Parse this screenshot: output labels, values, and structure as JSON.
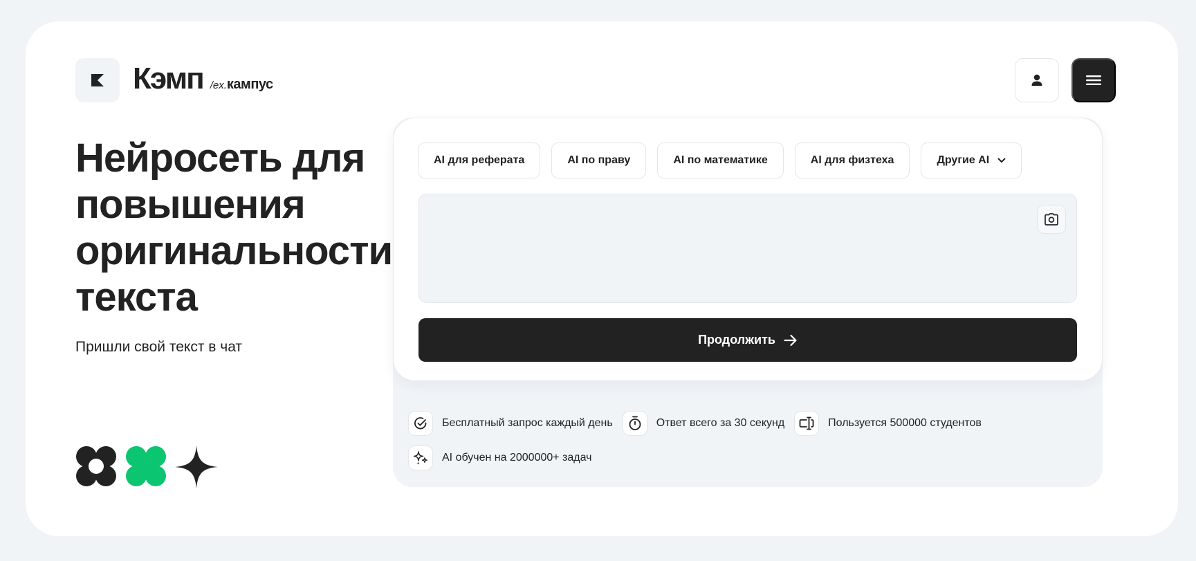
{
  "brand": {
    "name": "Кэмп",
    "ex_prefix": "/ex.",
    "old_name": "кампус",
    "logo_icon": "k-logo-icon"
  },
  "header": {
    "user_icon": "user-icon",
    "menu_icon": "hamburger-menu-icon"
  },
  "hero": {
    "title": "Нейросеть для повышения оригинальности текста",
    "subtitle": "Пришли свой текст в чат"
  },
  "form": {
    "tabs": [
      {
        "label": "AI для реферата"
      },
      {
        "label": "AI по праву"
      },
      {
        "label": "AI по математике"
      },
      {
        "label": "AI для физтеха"
      },
      {
        "label": "Другие AI",
        "has_dropdown": true
      }
    ],
    "input_placeholder": "",
    "camera_icon": "camera-icon",
    "submit_label": "Продолжить",
    "submit_icon": "arrow-right-icon"
  },
  "features": [
    {
      "icon": "check-circle-icon",
      "text": "Бесплатный запрос каждый день"
    },
    {
      "icon": "stopwatch-icon",
      "text": "Ответ всего за 30 секунд"
    },
    {
      "icon": "text-cursor-icon",
      "text": "Пользуется 500000 студентов"
    },
    {
      "icon": "sparkles-icon",
      "text": "AI обучен на 2000000+ задач"
    }
  ],
  "colors": {
    "background": "#f1f4f7",
    "card": "#ffffff",
    "dark": "#222222",
    "accent_green": "#0bc570"
  }
}
